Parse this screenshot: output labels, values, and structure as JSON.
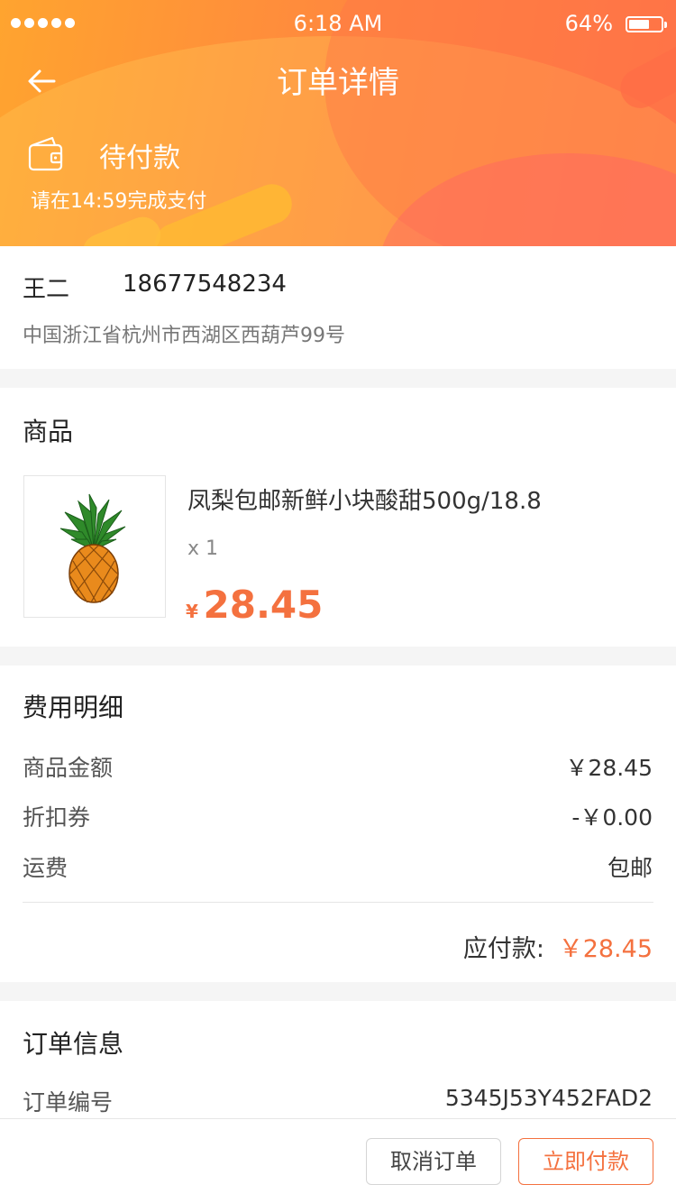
{
  "status_bar": {
    "time": "6:18 AM",
    "battery_percent": "64%",
    "battery_level": 0.64
  },
  "nav": {
    "title": "订单详情"
  },
  "order_status": {
    "title": "待付款",
    "subtitle": "请在14:59完成支付"
  },
  "address": {
    "name": "王二",
    "phone": "18677548234",
    "detail": "中国浙江省杭州市西湖区西葫芦99号"
  },
  "goods": {
    "section_title": "商品",
    "name": "凤梨包邮新鲜小块酸甜500g/18.8",
    "quantity": "x 1",
    "price_currency": "¥",
    "price": "28.45"
  },
  "fees": {
    "section_title": "费用明细",
    "rows": [
      {
        "label": "商品金额",
        "value": "￥28.45"
      },
      {
        "label": "折扣券",
        "value": "-￥0.00"
      },
      {
        "label": "运费",
        "value": "包邮"
      }
    ],
    "total_label": "应付款:",
    "total_value": "￥28.45"
  },
  "order_info": {
    "section_title": "订单信息",
    "rows": [
      {
        "label": "订单编号",
        "value": "5345J53Y452FAD2"
      }
    ]
  },
  "actions": {
    "cancel": "取消订单",
    "pay": "立即付款"
  },
  "colors": {
    "accent": "#f4713f",
    "header_start": "#ffa42f",
    "header_end": "#ff6f48"
  }
}
